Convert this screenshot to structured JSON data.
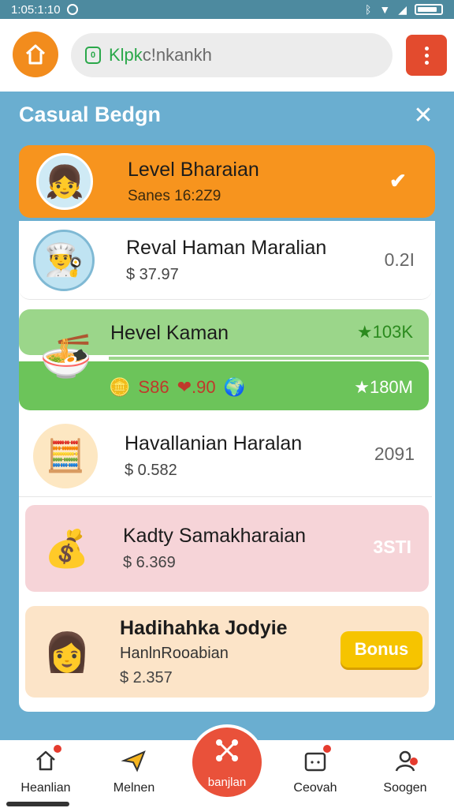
{
  "status_bar": {
    "time": "1:05:1:10",
    "icons": [
      "circle-icon",
      "bluetooth-icon",
      "wifi-icon",
      "signal-icon",
      "battery-icon"
    ]
  },
  "browser": {
    "url_prefix": "Klpk",
    "url_rest": "c!nkankh"
  },
  "panel": {
    "title": "Casual Bedgn"
  },
  "items": [
    {
      "title": "Level Bharaian",
      "sub": "Sanes 16:2Z9",
      "value": ""
    },
    {
      "title": "Reval Haman Maralian",
      "sub": "$ 37.97",
      "value": "0.2I"
    },
    {
      "title": "Hevel Kaman",
      "stat1": "★103K",
      "gold": [
        "S86",
        "❤.90"
      ],
      "stat2": "★180M"
    },
    {
      "title": "Havallanian Haralan",
      "sub": "$ 0.582",
      "value": "2091"
    },
    {
      "title": "Kadty Samakharaian",
      "sub": "$ 6.369",
      "value": "3STI"
    },
    {
      "title": "Hadihahka Jodyie",
      "mid": "HanlnRooabian",
      "sub": "$ 2.357",
      "button": "Bonus"
    }
  ],
  "nav": [
    {
      "label": "Heanlian",
      "icon": "home-icon"
    },
    {
      "label": "Melnen",
      "icon": "plane-icon"
    },
    {
      "label": "banjlan",
      "icon": "share-icon"
    },
    {
      "label": "Ceovah",
      "icon": "calendar-icon"
    },
    {
      "label": "Soogen",
      "icon": "user-icon"
    }
  ],
  "colors": {
    "accent_orange": "#f7941e",
    "accent_red": "#e9513a",
    "panel_blue": "#6aaed0",
    "green": "#6cc45a"
  }
}
